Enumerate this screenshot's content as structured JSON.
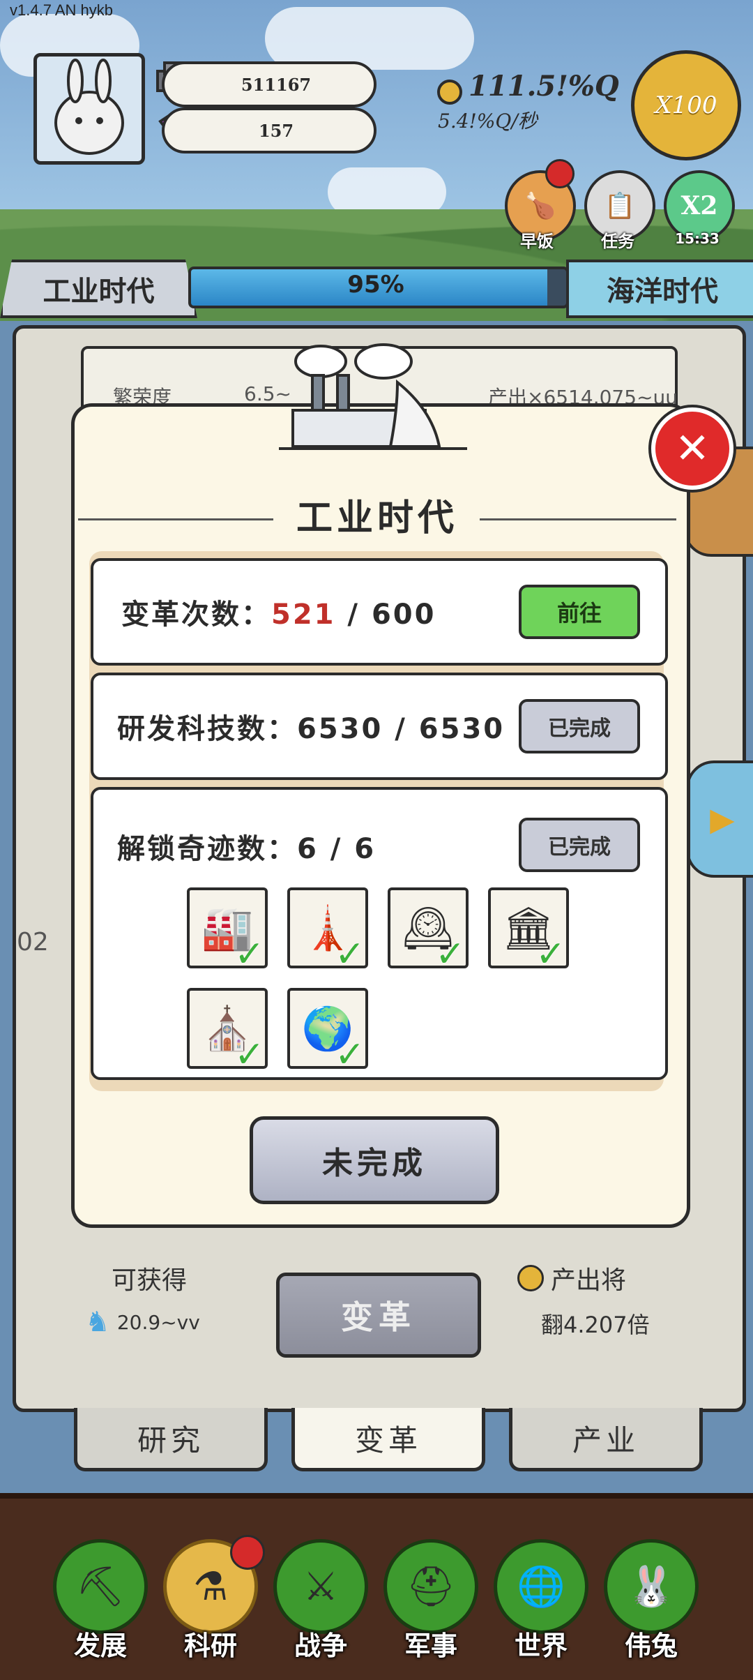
{
  "version": "v1.4.7 AN hykb",
  "resources": {
    "stone": "511167",
    "gem": "157"
  },
  "gold": {
    "amount": "111.5!%Q",
    "rate": "5.4!%Q/秒"
  },
  "multiplier": "X100",
  "top_buttons": [
    {
      "label": "早饭",
      "icon": "chicken-leg-icon"
    },
    {
      "label": "任务",
      "icon": "clipboard-icon"
    },
    {
      "label": "15:33",
      "icon": "x2-icon",
      "text": "X2"
    }
  ],
  "era": {
    "current": "工业时代",
    "next": "海洋时代",
    "progress_label": "95%",
    "progress": 0.95
  },
  "background_strip": {
    "left": "繁荣度",
    "mid": "6.5~",
    "right": "产出×6514.075~uu"
  },
  "background_marks": {
    "left_text": "02"
  },
  "modal": {
    "title": "工业时代",
    "rows": {
      "reform": {
        "label": "变革次数：",
        "current": "521",
        "sep": " / ",
        "total": "600",
        "button": "前往"
      },
      "tech": {
        "label": "研发科技数：",
        "value": "6530 / 6530",
        "button": "已完成"
      },
      "wonders": {
        "label": "解锁奇迹数：",
        "value": "6 / 6",
        "button": "已完成",
        "items": [
          {
            "icon": "power-plant-icon",
            "glyph": "🏭"
          },
          {
            "icon": "eiffel-tower-icon",
            "glyph": "🗼"
          },
          {
            "icon": "big-ben-icon",
            "glyph": "🕰"
          },
          {
            "icon": "palace-icon",
            "glyph": "🏛"
          },
          {
            "icon": "cathedral-icon",
            "glyph": "⛪"
          },
          {
            "icon": "globe-icon",
            "glyph": "🌍"
          }
        ]
      }
    },
    "status_button": "未完成"
  },
  "obtain": {
    "title": "可获得",
    "value": "20.9~vv"
  },
  "reform_button": "变革",
  "output": {
    "title": "产出将",
    "value": "翻4.207倍"
  },
  "sub_tabs": [
    "研究",
    "变革",
    "产业"
  ],
  "nav": [
    {
      "label": "发展",
      "icon": "axe-icon",
      "glyph": "⛏"
    },
    {
      "label": "科研",
      "icon": "flask-icon",
      "glyph": "⚗"
    },
    {
      "label": "战争",
      "icon": "swords-icon",
      "glyph": "⚔"
    },
    {
      "label": "军事",
      "icon": "helmet-icon",
      "glyph": "⛑"
    },
    {
      "label": "世界",
      "icon": "world-icon",
      "glyph": "🌐"
    },
    {
      "label": "伟兔",
      "icon": "rabbit-portrait-icon",
      "glyph": "🐰"
    }
  ],
  "colors": {
    "accent_green": "#6fd35a",
    "close_red": "#e02a2a",
    "progress_blue": "#2b86c6",
    "gold": "#e4b43a"
  }
}
